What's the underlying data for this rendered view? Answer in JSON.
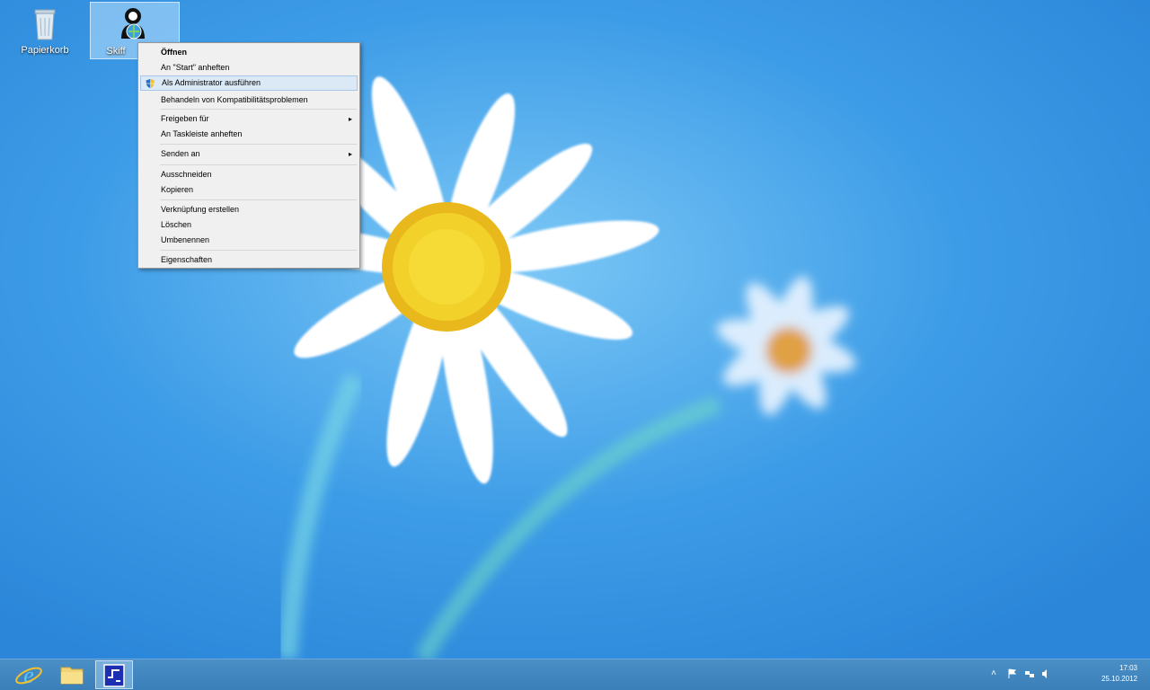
{
  "desktop": {
    "icons": [
      {
        "label": "Papierkorb",
        "icon": "recycle-bin-icon"
      },
      {
        "label": "Skiff",
        "icon": "app-user-globe-icon"
      }
    ]
  },
  "context_menu": {
    "items": [
      {
        "label": "Öffnen",
        "bold": true
      },
      {
        "label": "An \"Start\" anheften"
      },
      {
        "label": "Als Administrator ausführen",
        "icon": "uac-shield-icon",
        "highlighted": true
      },
      {
        "label": "Behandeln von Kompatibilitätsproblemen"
      },
      {
        "label": "Freigeben für",
        "submenu": true
      },
      {
        "label": "An Taskleiste anheften"
      },
      {
        "label": "Senden an",
        "submenu": true
      },
      {
        "label": "Ausschneiden"
      },
      {
        "label": "Kopieren"
      },
      {
        "label": "Verknüpfung erstellen"
      },
      {
        "label": "Löschen"
      },
      {
        "label": "Umbenennen"
      },
      {
        "label": "Eigenschaften"
      }
    ],
    "submenu_arrow": "▸"
  },
  "taskbar": {
    "buttons": [
      "internet-explorer-icon",
      "file-explorer-icon",
      "active-app-icon"
    ],
    "tray": {
      "show_hidden": "˄",
      "time": "17:03",
      "date": "25.10.2012"
    }
  },
  "colors": {
    "desktop_blue": "#3b9ae6",
    "taskbar": "#3a7fb8",
    "menu_bg": "#f0f0f0",
    "menu_highlight": "#dbe8f6"
  }
}
